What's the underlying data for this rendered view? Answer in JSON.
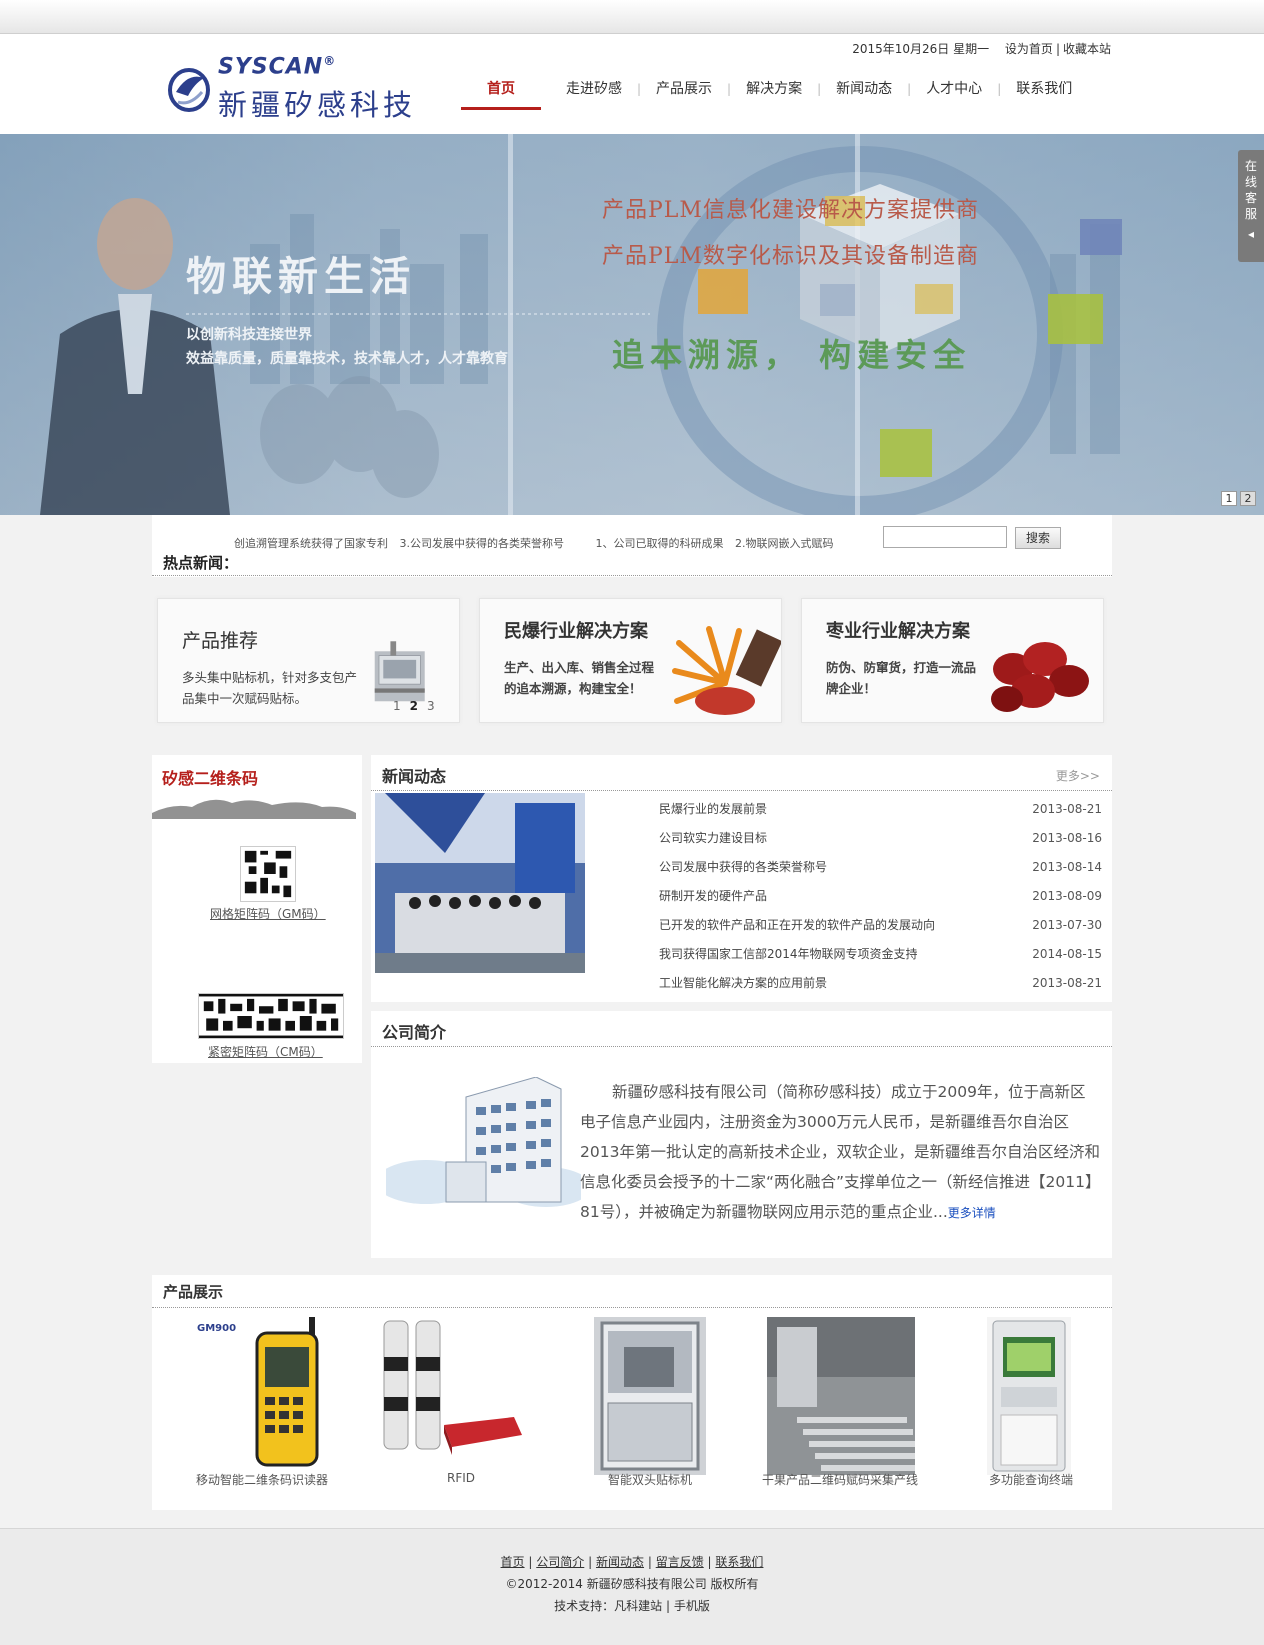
{
  "header": {
    "brand_en": "SYSCAN",
    "brand_reg": "®",
    "brand_cn": "新疆矽感科技",
    "date": "2015年10月26日 星期一",
    "set_home": "设为首页",
    "favorite": "收藏本站",
    "sep": "|"
  },
  "nav": [
    {
      "label": "首页",
      "active": true
    },
    {
      "label": "走进矽感"
    },
    {
      "label": "产品展示"
    },
    {
      "label": "解决方案"
    },
    {
      "label": "新闻动态"
    },
    {
      "label": "人才中心"
    },
    {
      "label": "联系我们"
    }
  ],
  "banner": {
    "slogan_big": "物联新生活",
    "slogan_line1": "以创新科技连接世界",
    "slogan_line2": "效益靠质量，质量靠技术，技术靠人才，人才靠教育",
    "right_line1": "产品PLM信息化建设解决方案提供商",
    "right_line2": "产品PLM数字化标识及其设备制造商",
    "right_line3": "追本溯源， 构建安全",
    "service_tab": "在线客服",
    "pages": [
      "1",
      "2"
    ],
    "active_page": 1
  },
  "hotnews": {
    "label": "热点新闻：",
    "items": [
      "创追溯管理系统获得了国家专利",
      "3.公司发展中获得的各类荣誉称号",
      "1、公司已取得的科研成果",
      "2.物联网嵌入式赋码"
    ],
    "search_placeholder": "",
    "search_button": "搜索"
  },
  "features": [
    {
      "title": "产品推荐",
      "desc": "多头集中贴标机，针对多支包产品集中一次赋码贴标。",
      "dots": [
        "1",
        "2",
        "3"
      ],
      "active_dot": 2
    },
    {
      "title": "民爆行业解决方案",
      "desc": "生产、出入库、销售全过程的追本溯源，构建宝全！"
    },
    {
      "title": "枣业行业解决方案",
      "desc": "防伪、防窜货，打造一流品牌企业！"
    }
  ],
  "barcodes": {
    "title": "矽感二维条码",
    "gm_caption": "网格矩阵码（GM码）",
    "cm_caption": "紧密矩阵码（CM码）"
  },
  "news": {
    "title": "新闻动态",
    "more": "更多>>",
    "items": [
      {
        "title": "民爆行业的发展前景",
        "date": "2013-08-21"
      },
      {
        "title": "公司软实力建设目标",
        "date": "2013-08-16"
      },
      {
        "title": "公司发展中获得的各类荣誉称号",
        "date": "2013-08-14"
      },
      {
        "title": "研制开发的硬件产品",
        "date": "2013-08-09"
      },
      {
        "title": "已开发的软件产品和正在开发的软件产品的发展动向",
        "date": "2013-07-30"
      },
      {
        "title": "我司获得国家工信部2014年物联网专项资金支持",
        "date": "2014-08-15"
      },
      {
        "title": "工业智能化解决方案的应用前景",
        "date": "2013-08-21"
      }
    ]
  },
  "intro": {
    "title": "公司简介",
    "text": "新疆矽感科技有限公司（简称矽感科技）成立于2009年，位于高新区电子信息产业园内，注册资金为3000万元人民币，是新疆维吾尔自治区2013年第一批认定的高新技术企业，双软企业，是新疆维吾尔自治区经济和信息化委员会授予的十二家“两化融合”支撑单位之一（新经信推进【2011】81号），并被确定为新疆物联网应用示范的重点企业...",
    "more": "更多详情"
  },
  "products": {
    "title": "产品展示",
    "items": [
      {
        "name": "移动智能二维条码识读器",
        "tag": "GM900"
      },
      {
        "name": "RFID"
      },
      {
        "name": "智能双头贴标机"
      },
      {
        "name": "干果产品二维码赋码采集产线"
      },
      {
        "name": "多功能查询终端"
      }
    ]
  },
  "footer": {
    "links": [
      "首页",
      "公司简介",
      "新闻动态",
      "留言反馈",
      "联系我们"
    ],
    "sep": "|",
    "copyright": "©2012-2014  新疆矽感科技有限公司 版权所有",
    "tech_label": "技术支持：",
    "tech_links": [
      "凡科建站",
      "手机版"
    ]
  },
  "colors": {
    "accent": "#b51f1b",
    "brand": "#2c3f8c",
    "link": "#1a4fbf"
  }
}
